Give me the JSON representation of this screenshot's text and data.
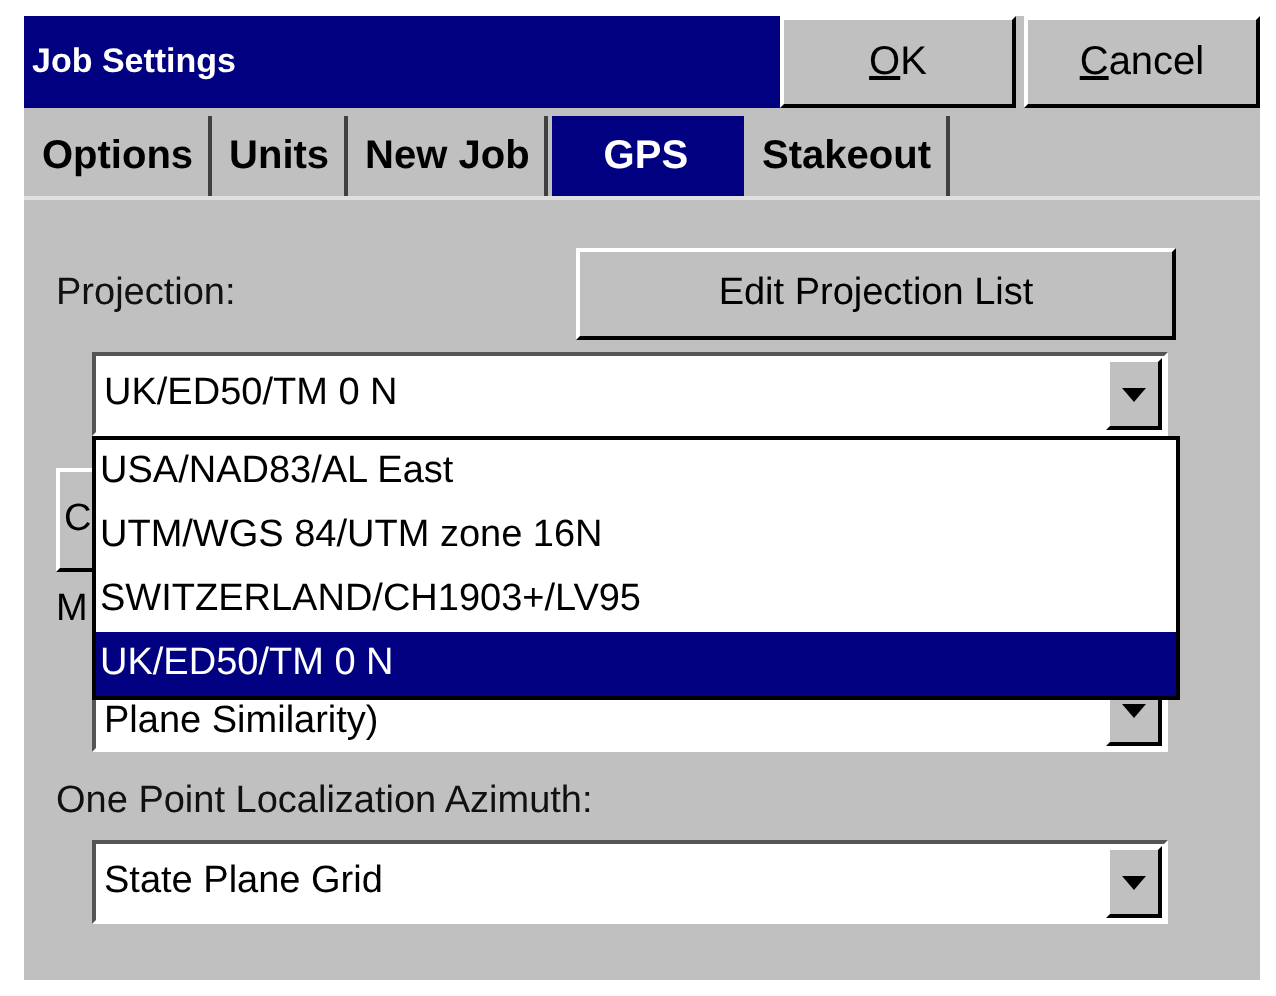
{
  "window": {
    "title": "Job Settings"
  },
  "buttons": [
    {
      "label": "OK",
      "underline_first": true
    },
    {
      "label": "Cancel",
      "underline_first": true
    }
  ],
  "tabs": [
    {
      "label": "Options",
      "selected": false
    },
    {
      "label": "Units",
      "selected": false
    },
    {
      "label": "New Job",
      "selected": false
    },
    {
      "label": "GPS",
      "selected": true
    },
    {
      "label": "Stakeout",
      "selected": false
    }
  ],
  "projection": {
    "label": "Projection:",
    "button": "Edit Projection List",
    "value": "UK/ED50/TM 0 N",
    "expanded": true,
    "options": [
      {
        "text": "USA/NAD83/AL East",
        "selected": false
      },
      {
        "text": "UTM/WGS 84/UTM zone 16N",
        "selected": false
      },
      {
        "text": "SWITZERLAND/CH1903+/LV95",
        "selected": false
      },
      {
        "text": "UK/ED50/TM 0 N",
        "selected": true
      }
    ]
  },
  "covered": {
    "button": "C",
    "label": "M",
    "value": "Plane Similarity)"
  },
  "azimuth": {
    "label": "One Point Localization Azimuth:",
    "value": "State Plane Grid"
  }
}
